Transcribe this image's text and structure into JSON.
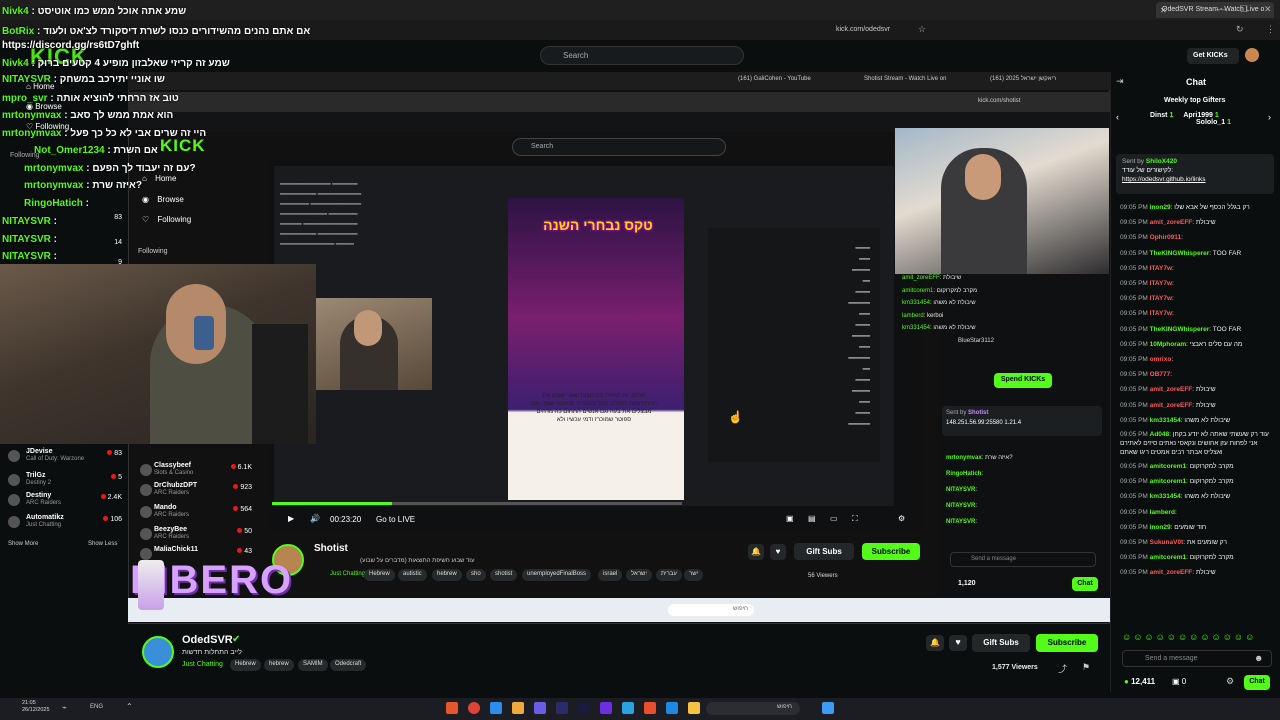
{
  "browser": {
    "tab_title": "OdedSVR Stream - Watch Live o",
    "url": "kick.com/odedsvr"
  },
  "overlay_chat": [
    {
      "user": "Nivk4",
      "msg": "שמע אתה אוכל ממש כמו אוטיסט"
    },
    {
      "user": "BotRix",
      "msg": "אם אתם נהנים מהשידורים כנסו לשרת דיסקורד לצ'אט ולעוד"
    },
    {
      "user": "",
      "msg": "https://discord.gg/rs6tD7ghft"
    },
    {
      "user": "Nivk4",
      "msg": "שמע זה קריזי שאלבזון מופיע 4 קטעים ברוק"
    },
    {
      "user": "NITAYSVR",
      "msg": "שו אוניי יתירכב במשחק"
    },
    {
      "user": "mpro_svr",
      "msg": "טוב אז הרחתי להוציא אותה"
    },
    {
      "user": "mrtonymvax",
      "msg": "הוא אמת ממש לך סאב"
    },
    {
      "user": "mrtonymvax",
      "msg": "היי זה שרים אבי לא כל כך פעל"
    },
    {
      "user": "Not_Omer1234",
      "msg": "אם השרת"
    },
    {
      "user": "mrtonymvax",
      "msg": "עם זה יעבוד לך הפעם?"
    },
    {
      "user": "mrtonymvax",
      "msg": "איזה שרת?"
    },
    {
      "user": "RingoHatich",
      "msg": ""
    },
    {
      "user": "NITAYSVR",
      "msg": ""
    },
    {
      "user": "NITAYSVR",
      "msg": ""
    },
    {
      "user": "NITAYSVR",
      "msg": ""
    }
  ],
  "kick": {
    "logo": "KICK",
    "search_placeholder": "Search",
    "get_kicks": "Get KICKs",
    "nav": {
      "home": "Home",
      "browse": "Browse",
      "following": "Following"
    },
    "following_header": "Following",
    "show_more": "Show More",
    "show_less": "Show Less"
  },
  "followed_channels": [
    {
      "name": "JDevise",
      "category": "Call of Duty: Warzone",
      "viewers": "83"
    },
    {
      "name": "TrilGz",
      "category": "Destiny 2",
      "viewers": "5"
    },
    {
      "name": "Destiny",
      "category": "ARC Raiders",
      "viewers": "2.4K"
    },
    {
      "name": "Automatikz",
      "category": "Just Chatting",
      "viewers": "106"
    }
  ],
  "inner_followed_channels": [
    {
      "name": "Classybeef",
      "category": "Slots & Casino",
      "viewers": "6.1K"
    },
    {
      "name": "DrChubzDPT",
      "category": "ARC Raiders",
      "viewers": "923"
    },
    {
      "name": "Mando",
      "category": "ARC Raiders",
      "viewers": "564"
    },
    {
      "name": "BeezyBee",
      "category": "ARC Raiders",
      "viewers": "50"
    },
    {
      "name": "MaliaChick11",
      "category": "",
      "viewers": "43"
    }
  ],
  "inner_side_counts": [
    "83",
    "14",
    "9"
  ],
  "inner_browser": {
    "tabs": [
      "(161) GaliCohen - YouTube",
      "Shotist Stream - Watch Live on",
      "(161) ריאקשן ישראל 2025"
    ],
    "url": "kick.com/shotist"
  },
  "inner_stream": {
    "time": "00:23:20",
    "go_live": "Go to LIVE",
    "channel": "Shotist",
    "title": "עוד שבוע חשיפת התוצאות (מדברים על שבוע)",
    "category": "Just Chatting",
    "tags": [
      "Hebrew",
      "autistic",
      "hebrew",
      "sho",
      "shotist",
      "unemployedFinalBoss",
      "israel",
      "ישראל",
      "עברית",
      "ישר"
    ],
    "viewers": "56 Viewers",
    "gift_subs": "Gift Subs",
    "subscribe": "Subscribe",
    "spend_kicks": "Spend KICKs",
    "sent_by": "Sent by",
    "sender": "Shotist",
    "pinned_ip": "148.251.56.99:25580 1.21.4",
    "send_placeholder": "Send a message",
    "kicks_balance": "1,120",
    "chat_btn": "Chat",
    "phone_title": "טקס נבחרי השנה",
    "phone_text": "תכלס, זה תחזית הקיבוצות שאני שובא את החתירותות החולה, בכל קטגוריה ספונטר שמך. וגם מבצלים את בעה וגם אנשים התחום כה מדהים ספוטר שמוכרז ודמי עכשיו ולא"
  },
  "inner_chat": [
    {
      "user": "amit_zoreEFF",
      "msg": "שיבולת"
    },
    {
      "user": "amitcorem1",
      "msg": "מקרב למקרוקום"
    },
    {
      "user": "km331454",
      "msg": "שיבולת לא משהו"
    },
    {
      "user": "lamberd",
      "msg": "kerboi"
    },
    {
      "user": "km331454",
      "msg": "שיבולת לא משהו"
    },
    {
      "user": "",
      "msg": "BlueStar3112"
    },
    {
      "user": "mrtonymvax",
      "msg": "איזה שרת?"
    },
    {
      "user": "RingoHatich",
      "msg": ""
    },
    {
      "user": "NITAYSVR",
      "msg": ""
    },
    {
      "user": "NITAYSVR",
      "msg": ""
    },
    {
      "user": "NITAYSVR",
      "msg": ""
    }
  ],
  "stream": {
    "channel": "OdedSVR",
    "title": "לייב התחלות חדשות",
    "category": "Just Chatting",
    "tags": [
      "Hebrew",
      "hebrew",
      "SAMIM",
      "Odedcraft"
    ],
    "viewers": "1,577 Viewers",
    "gift_subs": "Gift Subs",
    "subscribe": "Subscribe"
  },
  "chat": {
    "title": "Chat",
    "top_gifters_label": "Weekly top Gifters",
    "gifters": [
      {
        "name": "Dinst",
        "count": "1"
      },
      {
        "name": "Apri1999",
        "count": "1"
      },
      {
        "name": "Sololo_1",
        "count": "1"
      }
    ],
    "pinned_by_label": "Sent by",
    "pinned_by": "ShiloX420",
    "pinned_text": "לקישורים של עודד:",
    "pinned_link": "https://odedsvr.github.io/links",
    "messages": [
      {
        "time": "09:05 PM",
        "user": "inon29",
        "color": "#53fc18",
        "msg": "רק בגלל הכסף של אבא שלו"
      },
      {
        "time": "09:05 PM",
        "user": "amit_zoreEFF",
        "color": "#ff5a5a",
        "msg": "שיבולת"
      },
      {
        "time": "09:05 PM",
        "user": "Ophir0911",
        "color": "#ff5a5a",
        "msg": ""
      },
      {
        "time": "09:05 PM",
        "user": "TheKINGWhisperer",
        "color": "#53fc18",
        "msg": "TOO FAR"
      },
      {
        "time": "09:05 PM",
        "user": "ITAY7w",
        "color": "#ff5a5a",
        "msg": ""
      },
      {
        "time": "09:05 PM",
        "user": "ITAY7w",
        "color": "#ff5a5a",
        "msg": ""
      },
      {
        "time": "09:05 PM",
        "user": "ITAY7w",
        "color": "#ff5a5a",
        "msg": ""
      },
      {
        "time": "09:05 PM",
        "user": "ITAY7w",
        "color": "#ff5a5a",
        "msg": ""
      },
      {
        "time": "09:05 PM",
        "user": "TheKINGWhisperer",
        "color": "#53fc18",
        "msg": "TOO FAR"
      },
      {
        "time": "09:05 PM",
        "user": "10Mphoram",
        "color": "#53fc18",
        "msg": "מה עם סלים ראבצי"
      },
      {
        "time": "09:05 PM",
        "user": "omrixo",
        "color": "#ff5a5a",
        "msg": ""
      },
      {
        "time": "09:05 PM",
        "user": "OB777",
        "color": "#ff5a5a",
        "msg": ""
      },
      {
        "time": "09:05 PM",
        "user": "amit_zoreEFF",
        "color": "#ff5a5a",
        "msg": "שיבולת"
      },
      {
        "time": "09:05 PM",
        "user": "amit_zoreEFF",
        "color": "#ff5a5a",
        "msg": "שיבולת"
      },
      {
        "time": "09:05 PM",
        "user": "km331454",
        "color": "#53fc18",
        "msg": "שיבולת לא משהו"
      },
      {
        "time": "09:05 PM",
        "user": "Ad048",
        "color": "#53fc18",
        "msg": "עוד רק שעשתי שאתה לא יודע בקחן אני לפחות עזן אחושים ונקאסי נאתים סיזים לאתירם ואצליס אבתר רבים אמטים ריגו שאתם"
      },
      {
        "time": "09:05 PM",
        "user": "amitcorem1",
        "color": "#53fc18",
        "msg": "מקרב למקרוקום"
      },
      {
        "time": "09:05 PM",
        "user": "amitcorem1",
        "color": "#53fc18",
        "msg": "מקרב למקרוקום"
      },
      {
        "time": "09:05 PM",
        "user": "km331454",
        "color": "#53fc18",
        "msg": "שיבולת לא משהו"
      },
      {
        "time": "09:05 PM",
        "user": "lamberd",
        "color": "#53fc18",
        "msg": ""
      },
      {
        "time": "09:05 PM",
        "user": "inon29",
        "color": "#53fc18",
        "msg": "חוד שומעים"
      },
      {
        "time": "09:05 PM",
        "user": "SukunaV0t",
        "color": "#ff5a5a",
        "msg": "רק שומעים את"
      },
      {
        "time": "09:05 PM",
        "user": "amitcorem1",
        "color": "#53fc18",
        "msg": "מקרב למקרוקום"
      },
      {
        "time": "09:05 PM",
        "user": "amit_zoreEFF",
        "color": "#ff5a5a",
        "msg": "שיבולת"
      }
    ],
    "send_placeholder": "Send a message",
    "kicks_balance": "12,411",
    "chat_btn": "Chat",
    "zero_count": "0"
  },
  "taskbar": {
    "time": "21:05",
    "date": "26/12/2025",
    "lang": "ENG",
    "search": "חיפוש"
  },
  "watermark": "LIBERO",
  "colors": {
    "accent": "#53fc18",
    "background": "#0b0e0f"
  }
}
